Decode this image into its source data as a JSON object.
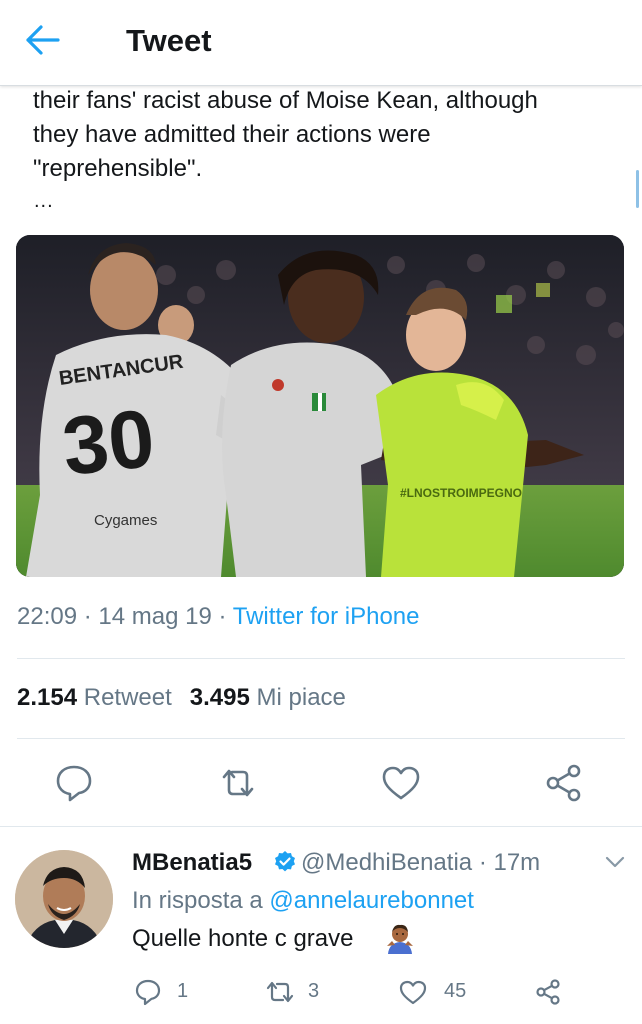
{
  "header": {
    "title": "Tweet"
  },
  "tweet": {
    "text_lines": [
      "their fans' racist abuse of Moise Kean, although",
      "they have  admitted their actions were",
      "\"reprehensible\"."
    ],
    "ellipsis": "...",
    "jersey_name": "BENTANCUR",
    "jersey_number": "30",
    "jersey_sponsor": "Cygames",
    "keeper_text": "#LNOSTROIMPEGNO",
    "time": "22:09",
    "date": "14 mag 19",
    "separator": "·",
    "source": "Twitter for iPhone",
    "retweets_count": "2.154",
    "retweets_label": "Retweet",
    "likes_count": "3.495",
    "likes_label": "Mi piace"
  },
  "reply": {
    "name": "MBenatia5",
    "handle": "@MedhiBenatia",
    "time": "· 17m",
    "in_reply_prefix": "In risposta a",
    "in_reply_handle": "@annelaurebonnet",
    "text": "Quelle honte c grave",
    "replies": "1",
    "retweets": "3",
    "likes": "45"
  },
  "colors": {
    "accent": "#1da1f2",
    "secondary_text": "#657786",
    "primary_text": "#14171a",
    "divider": "#e1e8ed"
  },
  "icons": {
    "back": "arrow-left-icon",
    "reply": "speech-bubble-icon",
    "retweet": "retweet-arrows-icon",
    "like": "heart-icon",
    "share": "share-nodes-icon",
    "verified": "verified-badge-icon",
    "more": "chevron-down-icon",
    "emoji": "person-shrugging-emoji"
  }
}
